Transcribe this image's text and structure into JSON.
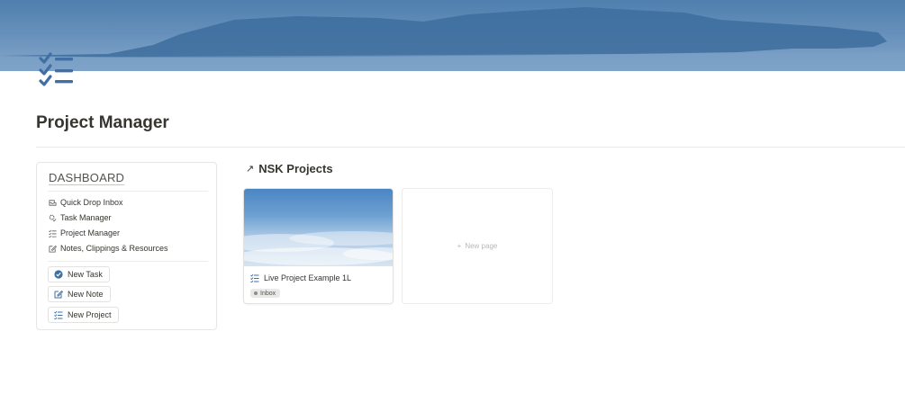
{
  "page": {
    "title": "Project Manager",
    "icon": "checklist-icon"
  },
  "dashboard": {
    "title": "DASHBOARD",
    "links": [
      {
        "label": "Quick Drop Inbox",
        "icon": "inbox-icon"
      },
      {
        "label": "Task Manager",
        "icon": "gear-check-icon"
      },
      {
        "label": "Project Manager",
        "icon": "checklist-icon"
      },
      {
        "label": "Notes, Clippings & Resources",
        "icon": "edit-icon"
      }
    ],
    "buttons": [
      {
        "label": "New Task",
        "icon": "check-circle-icon"
      },
      {
        "label": "New Note",
        "icon": "edit-icon"
      },
      {
        "label": "New Project",
        "icon": "checklist-icon"
      }
    ]
  },
  "gallery": {
    "title": "NSK Projects",
    "arrow": "↗",
    "cards": [
      {
        "title": "Live Project Example 1L",
        "tag": "Inbox"
      }
    ],
    "new_page_label": "New page",
    "new_page_plus": "+"
  },
  "colors": {
    "accent": "#3f6fa5",
    "text": "#37352f"
  }
}
